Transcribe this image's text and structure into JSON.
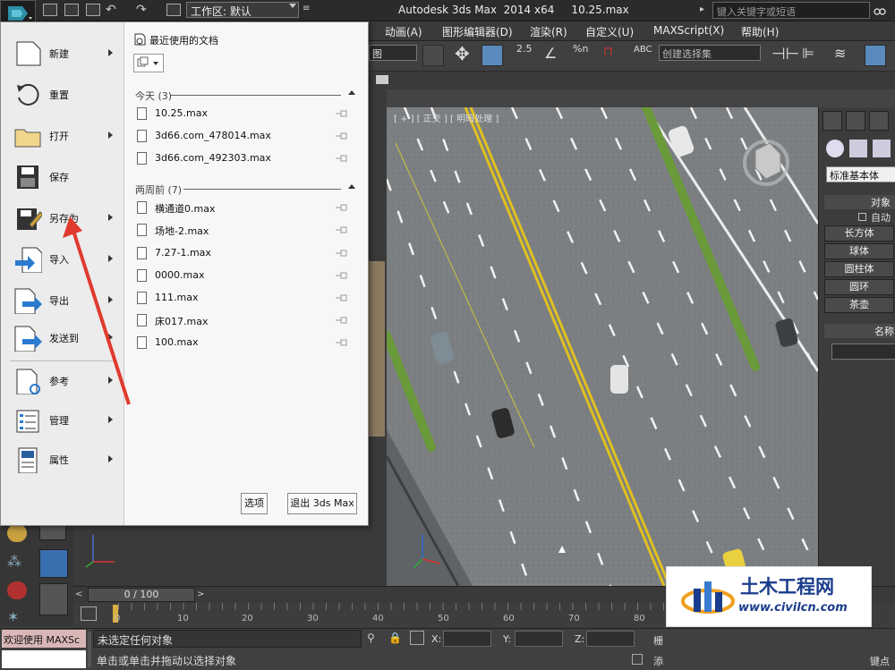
{
  "titlebar": {
    "workspace": "工作区: 默认",
    "app_title": "Autodesk 3ds Max  2014 x64     10.25.max",
    "search_placeholder": "键入关键字或短语"
  },
  "menubar": {
    "items": [
      "动画(A)",
      "图形编辑器(D)",
      "渲染(R)",
      "自定义(U)",
      "MAXScript(X)",
      "帮助(H)"
    ]
  },
  "toolbar": {
    "view_dropdown": "图",
    "selection_set_placeholder": "创建选择集",
    "snap_labels": [
      "2.5",
      "%n"
    ]
  },
  "app_menu": {
    "items": [
      {
        "label": "新建",
        "icon": "new-file-icon",
        "has_submenu": true
      },
      {
        "label": "重置",
        "icon": "reset-icon",
        "has_submenu": false
      },
      {
        "label": "打开",
        "icon": "open-folder-icon",
        "has_submenu": true
      },
      {
        "label": "保存",
        "icon": "save-icon",
        "has_submenu": false
      },
      {
        "label": "另存为",
        "icon": "save-as-icon",
        "has_submenu": true
      },
      {
        "label": "导入",
        "icon": "import-icon",
        "has_submenu": true
      },
      {
        "label": "导出",
        "icon": "export-icon",
        "has_submenu": true
      },
      {
        "label": "发送到",
        "icon": "send-to-icon",
        "has_submenu": true
      },
      {
        "label": "参考",
        "icon": "reference-icon",
        "has_submenu": true
      },
      {
        "label": "管理",
        "icon": "manage-icon",
        "has_submenu": true
      },
      {
        "label": "属性",
        "icon": "properties-icon",
        "has_submenu": true
      }
    ],
    "recent_title": "最近使用的文档",
    "sections": [
      {
        "title": "今天 (3)",
        "files": [
          "10.25.max",
          "3d66.com_478014.max",
          "3d66.com_492303.max"
        ]
      },
      {
        "title": "两周前 (7)",
        "files": [
          "横通道0.max",
          "场地-2.max",
          "7.27-1.max",
          "0000.max",
          "111.max",
          "床017.max",
          "100.max"
        ]
      }
    ],
    "options_button": "选项",
    "exit_button": "退出 3ds Max"
  },
  "viewport": {
    "label": "[ + ] [ 正交 ] [ 明暗处理 ]"
  },
  "command_panel": {
    "category": "标准基本体",
    "object_type_header": "对象",
    "autogrid": "自动",
    "buttons": [
      "长方体",
      "球体",
      "圆柱体",
      "圆环",
      "茶壶"
    ],
    "name_header": "名称"
  },
  "timeline": {
    "slider": "0 / 100",
    "ticks": [
      "0",
      "10",
      "20",
      "30",
      "40",
      "50",
      "60",
      "70",
      "80"
    ]
  },
  "statusbar": {
    "maxscript": "欢迎使用 MAXSc",
    "status_line1": "未选定任何对象",
    "status_line2": "单击或单击并拖动以选择对象",
    "coord_x": "X:",
    "coord_y": "Y:",
    "coord_z": "Z:",
    "grid_label": "栅",
    "add_label": "添",
    "key_label": "键点"
  },
  "watermark": {
    "title": "土木工程网",
    "url": "www.civilcn.com"
  },
  "colors": {
    "ui_dark": "#3a3a3a",
    "menu_bg": "#f3f3f3",
    "road": "#777b7e",
    "lane_yellow": "#e0c020",
    "grass": "#6a9a3a",
    "annotation_red": "#e03a2e",
    "watermark_blue": "#1a3c8c"
  }
}
